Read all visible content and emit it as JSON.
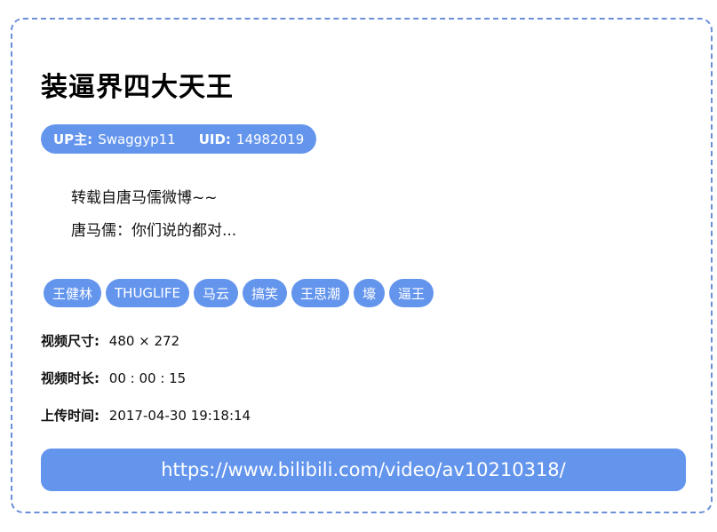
{
  "video": {
    "title": "装逼界四大天王",
    "uploader_label": "UP主:",
    "uploader_name": "Swaggyp11",
    "uid_label": "UID:",
    "uid_value": "14982019",
    "description_lines": [
      "转载自唐马儒微博~~",
      "唐马儒：你们说的都对..."
    ],
    "tags": [
      "王健林",
      "THUGLIFE",
      "马云",
      "搞笑",
      "王思潮",
      "壕",
      "逼王"
    ],
    "size_label": "视频尺寸:",
    "size_value": "480 × 272",
    "duration_label": "视频时长:",
    "duration_value": "00 : 00 : 15",
    "upload_label": "上传时间:",
    "upload_value": "2017-04-30  19:18:14",
    "url": "https://www.bilibili.com/video/av10210318/"
  },
  "colors": {
    "accent": "#6495ed",
    "border": "#6a8fd8"
  }
}
